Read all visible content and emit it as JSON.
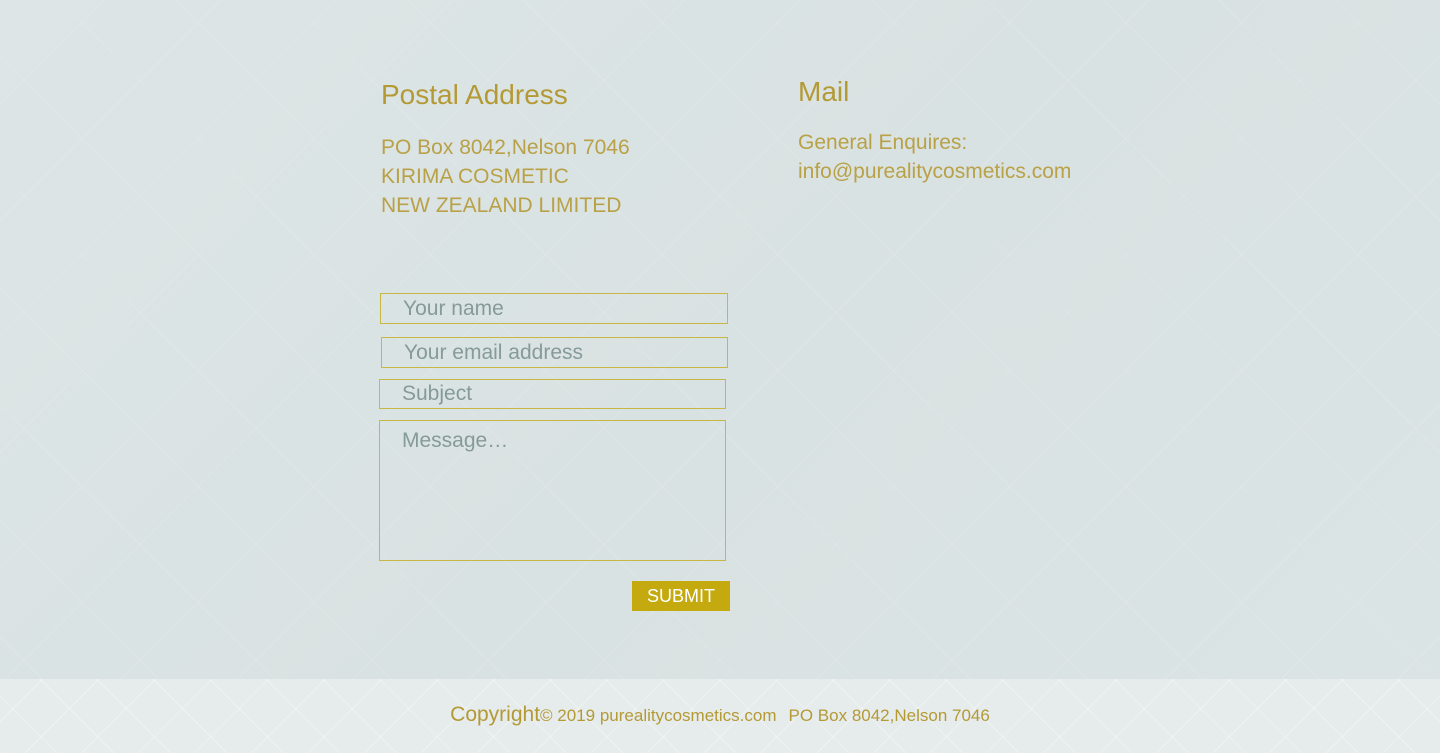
{
  "postal": {
    "title": "Postal Address",
    "lines": [
      "PO Box 8042,Nelson 7046",
      "KIRIMA COSMETIC",
      "NEW ZEALAND LIMITED"
    ]
  },
  "mail": {
    "title": "Mail",
    "label": "General Enquires:",
    "email": "info@purealitycosmetics.com"
  },
  "form": {
    "name_placeholder": "Your name",
    "email_placeholder": "Your email address",
    "subject_placeholder": "Subject",
    "message_placeholder": "Message…",
    "submit_label": "SUBMIT"
  },
  "footer": {
    "copyright_word": "Copyright",
    "copyright_rest": "© 2019 purealitycosmetics.com",
    "address": "PO Box 8042,Nelson 7046"
  },
  "colors": {
    "accent_gold": "#b49a35",
    "button_gold": "#c4aa0e",
    "background": "#dbe3e3"
  }
}
